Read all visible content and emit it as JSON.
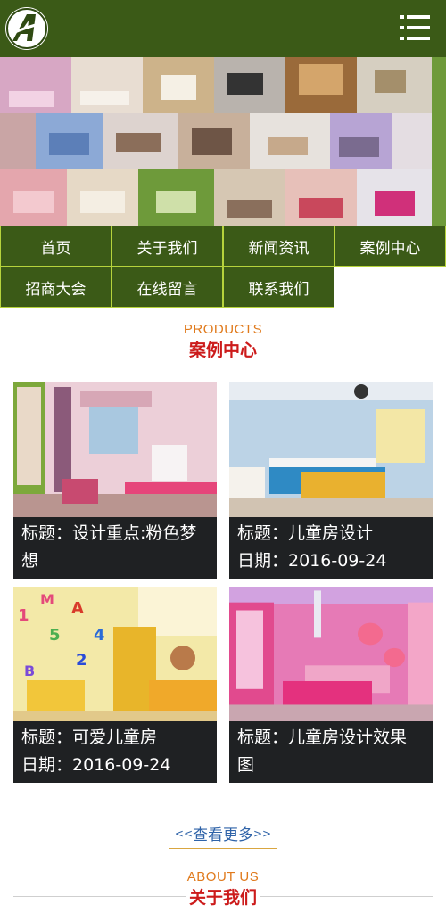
{
  "header": {
    "logo_letter": "A",
    "menu_icon": "hamburger-menu-icon",
    "bg_color": "#3b5a17"
  },
  "nav": {
    "items": [
      "首页",
      "关于我们",
      "新闻资讯",
      "案例中心",
      "招商大会",
      "在线留言",
      "联系我们"
    ]
  },
  "products": {
    "title_en": "PRODUCTS",
    "title_cn": "案例中心",
    "cards": [
      {
        "line1": "标题：设计重点:粉色梦",
        "line2": "想"
      },
      {
        "line1": "标题：儿童房设计",
        "line2": "日期：2016-09-24"
      },
      {
        "line1": "标题：可爱儿童房",
        "line2": "日期：2016-09-24"
      },
      {
        "line1": "标题：儿童房设计效果",
        "line2": "图"
      }
    ],
    "more_label": "查看更多",
    "more_left": "<<",
    "more_right": ">>"
  },
  "about": {
    "title_en": "ABOUT US",
    "title_cn": "关于我们"
  },
  "colors": {
    "accent_green": "#3b5a17",
    "border_green": "#b6d33c",
    "title_red": "#cc1b1b",
    "title_orange": "#e07a1c"
  }
}
